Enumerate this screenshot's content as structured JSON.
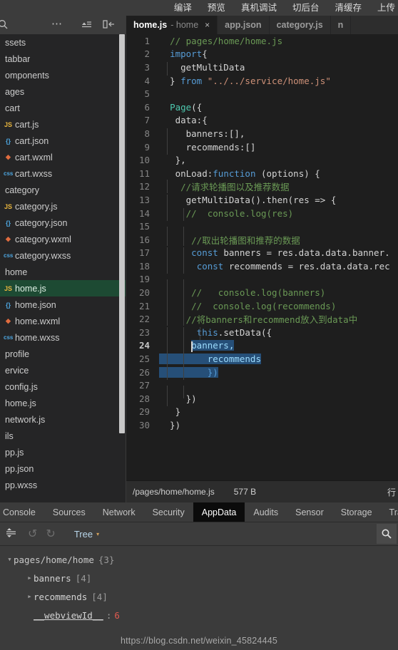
{
  "topbar": {
    "items": [
      "编译",
      "预览",
      "真机调试",
      "切后台",
      "清缓存",
      "上传"
    ]
  },
  "sidebar": {
    "icons": {
      "search": "search-icon",
      "more": "more-options-icon",
      "collapse": "collapse-all-icon",
      "panel": "toggle-panel-icon"
    },
    "files": [
      {
        "label": "ssets",
        "indent": 0,
        "type": "folder"
      },
      {
        "label": "tabbar",
        "indent": 0,
        "type": "folder"
      },
      {
        "label": "omponents",
        "indent": 0,
        "type": "folder"
      },
      {
        "label": "ages",
        "indent": 0,
        "type": "folder"
      },
      {
        "label": "cart",
        "indent": 0,
        "type": "folder"
      },
      {
        "label": "cart.js",
        "indent": 1,
        "type": "js"
      },
      {
        "label": "cart.json",
        "indent": 1,
        "type": "json"
      },
      {
        "label": "cart.wxml",
        "indent": 1,
        "type": "wxml"
      },
      {
        "label": "cart.wxss",
        "indent": 1,
        "type": "wxss"
      },
      {
        "label": "category",
        "indent": 0,
        "type": "folder"
      },
      {
        "label": "category.js",
        "indent": 1,
        "type": "js"
      },
      {
        "label": "category.json",
        "indent": 1,
        "type": "json"
      },
      {
        "label": "category.wxml",
        "indent": 1,
        "type": "wxml"
      },
      {
        "label": "category.wxss",
        "indent": 1,
        "type": "wxss"
      },
      {
        "label": "home",
        "indent": 0,
        "type": "folder"
      },
      {
        "label": "home.js",
        "indent": 1,
        "type": "js",
        "selected": true
      },
      {
        "label": "home.json",
        "indent": 1,
        "type": "json"
      },
      {
        "label": "home.wxml",
        "indent": 1,
        "type": "wxml"
      },
      {
        "label": "home.wxss",
        "indent": 1,
        "type": "wxss"
      },
      {
        "label": "profile",
        "indent": 0,
        "type": "folder"
      },
      {
        "label": "ervice",
        "indent": 0,
        "type": "folder"
      },
      {
        "label": "config.js",
        "indent": 0,
        "type": "folder"
      },
      {
        "label": "home.js",
        "indent": 0,
        "type": "folder"
      },
      {
        "label": "network.js",
        "indent": 0,
        "type": "folder"
      },
      {
        "label": "ils",
        "indent": 0,
        "type": "folder"
      },
      {
        "label": "pp.js",
        "indent": 0,
        "type": "folder"
      },
      {
        "label": "pp.json",
        "indent": 0,
        "type": "folder"
      },
      {
        "label": "pp.wxss",
        "indent": 0,
        "type": "folder"
      }
    ]
  },
  "tabs": [
    {
      "name": "home.js",
      "sub": "home",
      "close": "×",
      "active": true
    },
    {
      "name": "app.json",
      "sub": "",
      "active": false
    },
    {
      "name": "category.js",
      "sub": "",
      "active": false
    },
    {
      "name": "n",
      "sub": "",
      "active": false
    }
  ],
  "editor": {
    "lines": [
      {
        "n": 1,
        "tokens": [
          {
            "t": "  ",
            "c": "pln"
          },
          {
            "t": "// pages/home/home.js",
            "c": "cmt"
          }
        ]
      },
      {
        "n": 2,
        "tokens": [
          {
            "t": "  ",
            "c": "pln"
          },
          {
            "t": "import",
            "c": "kw"
          },
          {
            "t": "{",
            "c": "pun"
          }
        ]
      },
      {
        "n": 3,
        "tokens": [
          {
            "t": "    getMultiData",
            "c": "pln"
          }
        ],
        "guides": [
          1
        ]
      },
      {
        "n": 4,
        "tokens": [
          {
            "t": "  } ",
            "c": "pun"
          },
          {
            "t": "from",
            "c": "kw"
          },
          {
            "t": " ",
            "c": "pln"
          },
          {
            "t": "\"../../service/home.js\"",
            "c": "str"
          }
        ]
      },
      {
        "n": 5,
        "tokens": []
      },
      {
        "n": 6,
        "tokens": [
          {
            "t": "  ",
            "c": "pln"
          },
          {
            "t": "Page",
            "c": "fn"
          },
          {
            "t": "({",
            "c": "pun"
          }
        ]
      },
      {
        "n": 7,
        "tokens": [
          {
            "t": "   data:{",
            "c": "pln"
          }
        ]
      },
      {
        "n": 8,
        "tokens": [
          {
            "t": "     banners:[],",
            "c": "pln"
          }
        ],
        "guides": [
          1
        ]
      },
      {
        "n": 9,
        "tokens": [
          {
            "t": "     recommends:[]",
            "c": "pln"
          }
        ],
        "guides": [
          1
        ]
      },
      {
        "n": 10,
        "tokens": [
          {
            "t": "   },",
            "c": "pln"
          }
        ]
      },
      {
        "n": 11,
        "tokens": [
          {
            "t": "   onLoad:",
            "c": "pln"
          },
          {
            "t": "function",
            "c": "kw"
          },
          {
            "t": " (options) {",
            "c": "pln"
          }
        ]
      },
      {
        "n": 12,
        "tokens": [
          {
            "t": "    ",
            "c": "pln"
          },
          {
            "t": "//请求轮播图以及推荐数据",
            "c": "cmt"
          }
        ],
        "guides": [
          1
        ]
      },
      {
        "n": 13,
        "tokens": [
          {
            "t": "     getMultiData().then(res => {",
            "c": "pln"
          }
        ],
        "guides": [
          1
        ]
      },
      {
        "n": 14,
        "tokens": [
          {
            "t": "     ",
            "c": "pln"
          },
          {
            "t": "//  console.log(res)",
            "c": "cmt"
          }
        ],
        "guides": [
          1,
          2
        ]
      },
      {
        "n": 15,
        "tokens": [],
        "guides": [
          1,
          2
        ]
      },
      {
        "n": 16,
        "tokens": [
          {
            "t": "      ",
            "c": "pln"
          },
          {
            "t": "//取出轮播图和推荐的数据",
            "c": "cmt"
          }
        ],
        "guides": [
          1,
          2
        ]
      },
      {
        "n": 17,
        "tokens": [
          {
            "t": "      ",
            "c": "pln"
          },
          {
            "t": "const",
            "c": "kw"
          },
          {
            "t": " banners = res.data.data.banner.",
            "c": "pln"
          }
        ],
        "guides": [
          1,
          2
        ]
      },
      {
        "n": 18,
        "tokens": [
          {
            "t": "       ",
            "c": "pln"
          },
          {
            "t": "const",
            "c": "kw"
          },
          {
            "t": " recommends = res.data.data.rec",
            "c": "pln"
          }
        ],
        "guides": [
          1,
          2
        ]
      },
      {
        "n": 19,
        "tokens": [],
        "guides": [
          1,
          2
        ]
      },
      {
        "n": 20,
        "tokens": [
          {
            "t": "      ",
            "c": "pln"
          },
          {
            "t": "//   console.log(banners)",
            "c": "cmt"
          }
        ],
        "guides": [
          1,
          2
        ]
      },
      {
        "n": 21,
        "tokens": [
          {
            "t": "      ",
            "c": "pln"
          },
          {
            "t": "//  console.log(recommends)",
            "c": "cmt"
          }
        ],
        "guides": [
          1,
          2
        ]
      },
      {
        "n": 22,
        "tokens": [
          {
            "t": "     ",
            "c": "pln"
          },
          {
            "t": "//将banners和recommend放入到data中",
            "c": "cmt"
          }
        ],
        "guides": [
          1,
          2
        ]
      },
      {
        "n": 23,
        "tokens": [
          {
            "t": "       ",
            "c": "pln"
          },
          {
            "t": "this",
            "c": "kw"
          },
          {
            "t": ".setData({",
            "c": "pln"
          }
        ],
        "guides": [
          1,
          2,
          3
        ]
      },
      {
        "n": 24,
        "tokens": [
          {
            "t": "      ",
            "c": "pln"
          },
          {
            "t": "banners,",
            "c": "var",
            "sel": true
          }
        ],
        "guides": [
          1,
          2
        ],
        "current": true,
        "caret": 105
      },
      {
        "n": 25,
        "tokens": [
          {
            "t": "      recommends",
            "c": "var",
            "sel": true
          }
        ],
        "selfull": true,
        "guides": [
          1,
          2
        ]
      },
      {
        "n": 26,
        "tokens": [
          {
            "t": "      })",
            "c": "kw",
            "sel": true
          }
        ],
        "selfull": true,
        "guides": [
          1,
          2
        ]
      },
      {
        "n": 27,
        "tokens": [],
        "guides": [
          1,
          2
        ]
      },
      {
        "n": 28,
        "tokens": [
          {
            "t": "     })",
            "c": "pln"
          }
        ],
        "guides": [
          1
        ]
      },
      {
        "n": 29,
        "tokens": [
          {
            "t": "   }",
            "c": "pln"
          }
        ]
      },
      {
        "n": 30,
        "tokens": [
          {
            "t": "  })",
            "c": "pln"
          }
        ]
      }
    ]
  },
  "statusbar": {
    "path": "/pages/home/home.js",
    "size": "577 B",
    "right": "行"
  },
  "devtools": {
    "tabs": [
      {
        "label": "Console",
        "active": false,
        "cut": true
      },
      {
        "label": "Sources",
        "active": false
      },
      {
        "label": "Network",
        "active": false
      },
      {
        "label": "Security",
        "active": false
      },
      {
        "label": "AppData",
        "active": true
      },
      {
        "label": "Audits",
        "active": false
      },
      {
        "label": "Sensor",
        "active": false
      },
      {
        "label": "Storage",
        "active": false
      },
      {
        "label": "Trace",
        "active": false
      }
    ],
    "toolbar": {
      "expand_icon": "expand-collapse-icon",
      "undo_icon": "undo-icon",
      "redo_icon": "redo-icon",
      "view_mode": "Tree",
      "caret": "▾",
      "search_icon": "search-icon"
    },
    "tree": [
      {
        "arrow": "▼",
        "key": "pages/home/home",
        "meta": "{3}",
        "indent": 0,
        "dim": true
      },
      {
        "arrow": "▶",
        "key": "banners",
        "meta": "[4]",
        "indent": 1
      },
      {
        "arrow": "▶",
        "key": "recommends",
        "meta": "[4]",
        "indent": 1
      },
      {
        "arrow": "",
        "key": "__webviewId__",
        "meta": "",
        "indent": 1,
        "colon": ":",
        "value": "6",
        "underline": true
      }
    ]
  },
  "watermark": "https://blog.csdn.net/weixin_45824445"
}
